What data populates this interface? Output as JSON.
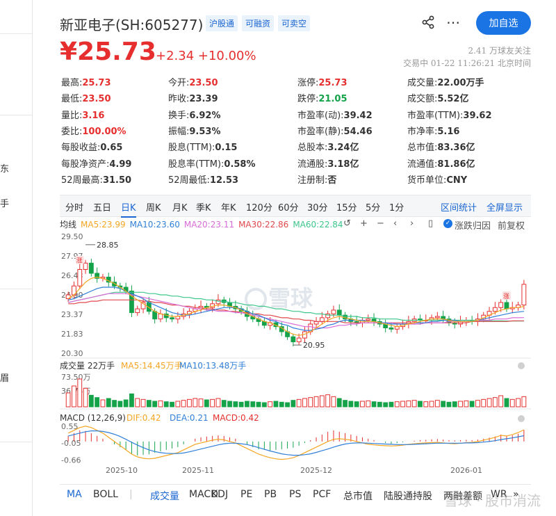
{
  "left_strip": {
    "frag_1": "东",
    "frag_2": "手",
    "frag_3": "眉"
  },
  "header": {
    "name": "新亚电子(SH:605277)",
    "tags": [
      "沪股通",
      "可融资",
      "可卖空"
    ],
    "follow_label": "加自选"
  },
  "price_row": {
    "price": "¥25.73",
    "change": "+2.34 +10.00%",
    "followers": "2.41 万球友关注",
    "status_time": "交易中 01-22 11:26:21 北京时间"
  },
  "quote": [
    [
      {
        "label": "最高:",
        "value": "25.73",
        "color": "red"
      },
      {
        "label": "今开:",
        "value": "23.50",
        "color": "red"
      },
      {
        "label": "涨停:",
        "value": "25.73",
        "color": "red"
      },
      {
        "label": "成交量:",
        "value": "22.00万手",
        "color": ""
      }
    ],
    [
      {
        "label": "最低:",
        "value": "23.50",
        "color": "red"
      },
      {
        "label": "昨收:",
        "value": "23.39",
        "color": ""
      },
      {
        "label": "跌停:",
        "value": "21.05",
        "color": "green"
      },
      {
        "label": "成交额:",
        "value": "5.52亿",
        "color": ""
      }
    ],
    [
      {
        "label": "量比:",
        "value": "3.16",
        "color": "red"
      },
      {
        "label": "换手:",
        "value": "6.92%",
        "color": ""
      },
      {
        "label": "市盈率(动):",
        "value": "39.42",
        "color": ""
      },
      {
        "label": "市盈率(TTM):",
        "value": "39.62",
        "color": ""
      }
    ],
    [
      {
        "label": "委比:",
        "value": "100.00%",
        "color": "red"
      },
      {
        "label": "振幅:",
        "value": "9.53%",
        "color": ""
      },
      {
        "label": "市盈率(静):",
        "value": "54.46",
        "color": ""
      },
      {
        "label": "市净率:",
        "value": "5.16",
        "color": ""
      }
    ],
    [
      {
        "label": "每股收益:",
        "value": "0.65",
        "color": ""
      },
      {
        "label": "股息(TTM):",
        "value": "0.15",
        "color": ""
      },
      {
        "label": "总股本:",
        "value": "3.24亿",
        "color": ""
      },
      {
        "label": "总市值:",
        "value": "83.36亿",
        "color": ""
      }
    ],
    [
      {
        "label": "每股净资产:",
        "value": "4.99",
        "color": ""
      },
      {
        "label": "股息率(TTM):",
        "value": "0.58%",
        "color": ""
      },
      {
        "label": "流通股:",
        "value": "3.18亿",
        "color": ""
      },
      {
        "label": "流通值:",
        "value": "81.86亿",
        "color": ""
      }
    ],
    [
      {
        "label": "52周最高:",
        "value": "31.50",
        "color": ""
      },
      {
        "label": "52周最低:",
        "value": "12.53",
        "color": ""
      },
      {
        "label": "注册制:",
        "value": "否",
        "color": ""
      },
      {
        "label": "货币单位:",
        "value": "CNY",
        "color": ""
      }
    ]
  ],
  "period_tabs": [
    "分时",
    "五日",
    "日K",
    "周K",
    "月K",
    "季K",
    "年K",
    "120分",
    "60分",
    "30分",
    "15分",
    "5分",
    "1分"
  ],
  "active_period": "日K",
  "period_links": [
    "区间统计",
    "全屏显示"
  ],
  "ma_legend": {
    "prefix": "均线",
    "items": [
      {
        "label": "MA5:23.99",
        "color": "#f5a623"
      },
      {
        "label": "MA10:23.60",
        "color": "#2f7fd8"
      },
      {
        "label": "MA20:23.11",
        "color": "#d86bd8"
      },
      {
        "label": "MA30:22.86",
        "color": "#e0474c"
      },
      {
        "label": "MA60:22.84",
        "color": "#3cc68a"
      }
    ]
  },
  "toolbar": {
    "toggle_label": "涨跌归因",
    "adjust_label": "前复权"
  },
  "colors": {
    "up": "#e62e2e",
    "down": "#15a34a",
    "accent": "#1a74e4"
  },
  "chart_data": [
    {
      "type": "candlestick",
      "y_ticks": [
        "29.50",
        "27.97",
        "26.43",
        "24.90",
        "23.37",
        "21.83",
        "20.30"
      ],
      "ylim": [
        20.3,
        29.5
      ],
      "annotations": {
        "high_label": "28.85",
        "low_label": "20.95",
        "up_marker": "涨"
      },
      "close": [
        24.9,
        25.6,
        26.9,
        27.4,
        26.6,
        26.2,
        26.3,
        25.9,
        25.6,
        25.5,
        25.2,
        23.5,
        23.8,
        24.3,
        23.6,
        23.0,
        23.4,
        23.1,
        23.0,
        23.2,
        23.4,
        23.6,
        23.8,
        24.0,
        23.9,
        24.2,
        24.5,
        24.3,
        24.0,
        23.8,
        23.6,
        23.2,
        23.0,
        22.8,
        22.5,
        22.7,
        22.4,
        22.0,
        21.6,
        21.2,
        21.5,
        22.0,
        22.6,
        22.8,
        23.1,
        23.4,
        23.7,
        23.3,
        23.0,
        22.8,
        22.7,
        22.9,
        23.0,
        22.8,
        22.6,
        22.3,
        22.2,
        22.4,
        22.6,
        22.8,
        23.0,
        22.9,
        22.9,
        23.1,
        23.2,
        23.0,
        22.7,
        22.6,
        22.8,
        22.9,
        22.8,
        23.0,
        23.3,
        23.6,
        23.9,
        24.3,
        23.8,
        23.9,
        24.1,
        25.73
      ],
      "ma5": [
        24.6,
        24.9,
        25.4,
        25.9,
        26.2,
        26.3,
        26.2,
        26.0,
        25.8,
        25.5,
        25.2,
        24.8,
        24.5,
        24.2,
        23.9,
        23.6,
        23.4,
        23.3,
        23.2,
        23.2,
        23.3,
        23.4,
        23.6,
        23.7,
        23.9,
        24.0,
        24.1,
        24.1,
        24.0,
        23.9,
        23.7,
        23.4,
        23.2,
        23.0,
        22.8,
        22.7,
        22.5,
        22.3,
        22.0,
        21.8,
        21.7,
        21.8,
        22.0,
        22.3,
        22.6,
        22.9,
        23.1,
        23.2,
        23.1,
        23.0,
        22.9,
        22.8,
        22.8,
        22.8,
        22.7,
        22.6,
        22.5,
        22.4,
        22.5,
        22.6,
        22.7,
        22.8,
        22.9,
        23.0,
        23.0,
        23.0,
        22.9,
        22.8,
        22.8,
        22.8,
        22.8,
        22.9,
        23.1,
        23.3,
        23.5,
        23.7,
        23.8,
        23.9,
        23.9,
        23.99
      ],
      "ma10": [
        24.5,
        24.6,
        24.8,
        25.0,
        25.2,
        25.4,
        25.5,
        25.5,
        25.5,
        25.4,
        25.2,
        25.0,
        24.8,
        24.6,
        24.3,
        24.1,
        23.9,
        23.7,
        23.5,
        23.4,
        23.3,
        23.3,
        23.4,
        23.5,
        23.6,
        23.7,
        23.8,
        23.9,
        23.9,
        23.9,
        23.8,
        23.6,
        23.4,
        23.3,
        23.1,
        22.9,
        22.8,
        22.6,
        22.5,
        22.3,
        22.2,
        22.1,
        22.1,
        22.2,
        22.3,
        22.5,
        22.6,
        22.8,
        22.9,
        22.9,
        22.9,
        22.9,
        22.8,
        22.8,
        22.7,
        22.7,
        22.6,
        22.6,
        22.6,
        22.6,
        22.7,
        22.7,
        22.7,
        22.8,
        22.8,
        22.9,
        22.9,
        22.9,
        22.8,
        22.8,
        22.8,
        22.9,
        23.0,
        23.1,
        23.2,
        23.3,
        23.4,
        23.5,
        23.55,
        23.6
      ],
      "ma20": [
        24.3,
        24.4,
        24.5,
        24.6,
        24.7,
        24.8,
        24.9,
        25.0,
        25.0,
        25.0,
        25.0,
        24.9,
        24.8,
        24.7,
        24.6,
        24.5,
        24.4,
        24.3,
        24.2,
        24.1,
        24.0,
        23.9,
        23.8,
        23.8,
        23.7,
        23.7,
        23.6,
        23.6,
        23.6,
        23.5,
        23.5,
        23.4,
        23.3,
        23.2,
        23.1,
        23.0,
        22.9,
        22.8,
        22.7,
        22.6,
        22.5,
        22.4,
        22.4,
        22.3,
        22.3,
        22.3,
        22.4,
        22.5,
        22.5,
        22.6,
        22.6,
        22.7,
        22.7,
        22.7,
        22.7,
        22.7,
        22.7,
        22.6,
        22.6,
        22.6,
        22.6,
        22.6,
        22.7,
        22.7,
        22.7,
        22.7,
        22.8,
        22.8,
        22.8,
        22.8,
        22.8,
        22.9,
        22.9,
        22.9,
        23.0,
        23.0,
        23.0,
        23.1,
        23.1,
        23.11
      ],
      "ma30": [
        24.2,
        24.2,
        24.3,
        24.3,
        24.4,
        24.4,
        24.5,
        24.5,
        24.5,
        24.5,
        24.5,
        24.5,
        24.5,
        24.4,
        24.4,
        24.3,
        24.3,
        24.2,
        24.1,
        24.1,
        24.0,
        24.0,
        23.9,
        23.9,
        23.8,
        23.8,
        23.7,
        23.7,
        23.6,
        23.6,
        23.5,
        23.5,
        23.4,
        23.4,
        23.3,
        23.3,
        23.2,
        23.1,
        23.1,
        23.0,
        23.0,
        22.9,
        22.9,
        22.8,
        22.8,
        22.8,
        22.8,
        22.8,
        22.7,
        22.7,
        22.7,
        22.7,
        22.7,
        22.7,
        22.7,
        22.7,
        22.7,
        22.7,
        22.7,
        22.7,
        22.7,
        22.7,
        22.7,
        22.7,
        22.7,
        22.7,
        22.7,
        22.7,
        22.7,
        22.7,
        22.8,
        22.8,
        22.8,
        22.8,
        22.8,
        22.8,
        22.8,
        22.85,
        22.86,
        22.86
      ],
      "ma60": [
        24.3,
        24.4,
        24.5,
        24.6,
        24.7,
        24.8,
        24.9,
        25.0,
        25.1,
        25.1,
        25.1,
        25.1,
        25.1,
        25.1,
        25.0,
        25.0,
        24.9,
        24.9,
        24.8,
        24.8,
        24.7,
        24.7,
        24.6,
        24.6,
        24.5,
        24.5,
        24.4,
        24.4,
        24.3,
        24.3,
        24.2,
        24.1,
        24.1,
        24.0,
        24.0,
        23.9,
        23.8,
        23.8,
        23.7,
        23.6,
        23.6,
        23.5,
        23.5,
        23.4,
        23.4,
        23.3,
        23.3,
        23.3,
        23.2,
        23.2,
        23.2,
        23.1,
        23.1,
        23.1,
        23.0,
        23.0,
        23.0,
        23.0,
        22.9,
        22.9,
        22.9,
        22.9,
        22.9,
        22.9,
        22.9,
        22.9,
        22.9,
        22.9,
        22.9,
        22.9,
        22.9,
        22.9,
        22.85,
        22.85,
        22.85,
        22.85,
        22.84,
        22.84,
        22.84,
        22.84
      ]
    },
    {
      "type": "bar",
      "title": "成交量 22万手",
      "legend": [
        {
          "label": "MA5:14.45万手",
          "color": "#f5a623"
        },
        {
          "label": "MA10:13.48万手",
          "color": "#2f7fd8"
        }
      ],
      "y_ticks": [
        "73.50万",
        "36.75万"
      ],
      "ylim": [
        0,
        73.5
      ],
      "values": [
        30,
        45,
        60,
        40,
        25,
        20,
        15,
        18,
        14,
        12,
        15,
        28,
        18,
        16,
        14,
        12,
        13,
        11,
        10,
        12,
        14,
        16,
        18,
        17,
        15,
        16,
        18,
        14,
        12,
        11,
        10,
        12,
        11,
        10,
        9,
        11,
        12,
        10,
        9,
        14,
        16,
        18,
        20,
        22,
        24,
        26,
        22,
        18,
        14,
        12,
        11,
        12,
        13,
        11,
        10,
        9,
        10,
        11,
        12,
        13,
        14,
        12,
        11,
        12,
        14,
        12,
        10,
        11,
        12,
        13,
        12,
        14,
        16,
        18,
        20,
        24,
        18,
        16,
        18,
        22
      ]
    },
    {
      "type": "bar",
      "title": "MACD (12,26,9)",
      "legend": [
        {
          "label": "DIF:0.42",
          "color": "#f5a623"
        },
        {
          "label": "DEA:0.21",
          "color": "#2f7fd8"
        },
        {
          "label": "MACD:0.42",
          "color": "#e62e2e"
        }
      ],
      "y_ticks": [
        "0.55",
        "-0.05",
        "-0.66"
      ],
      "ylim": [
        -0.75,
        0.62
      ],
      "values": [
        0.2,
        0.3,
        0.4,
        0.38,
        0.3,
        0.2,
        0.1,
        0.0,
        -0.1,
        -0.2,
        -0.3,
        -0.45,
        -0.5,
        -0.48,
        -0.46,
        -0.4,
        -0.35,
        -0.3,
        -0.25,
        -0.2,
        -0.1,
        0.0,
        0.1,
        0.15,
        0.18,
        0.2,
        0.22,
        0.2,
        0.15,
        0.1,
        0.0,
        -0.1,
        -0.2,
        -0.28,
        -0.3,
        -0.32,
        -0.3,
        -0.28,
        -0.25,
        -0.22,
        -0.15,
        -0.05,
        0.05,
        0.15,
        0.25,
        0.35,
        0.4,
        0.35,
        0.3,
        0.25,
        0.2,
        0.15,
        0.1,
        0.05,
        0.0,
        -0.05,
        -0.08,
        -0.06,
        -0.03,
        0.0,
        0.03,
        0.05,
        0.06,
        0.08,
        0.09,
        0.07,
        0.05,
        0.04,
        0.05,
        0.06,
        0.05,
        0.07,
        0.1,
        0.14,
        0.18,
        0.25,
        0.2,
        0.22,
        0.28,
        0.42
      ],
      "dif": [
        0.3,
        0.4,
        0.5,
        0.55,
        0.5,
        0.4,
        0.3,
        0.15,
        0.0,
        -0.15,
        -0.3,
        -0.45,
        -0.55,
        -0.6,
        -0.62,
        -0.6,
        -0.55,
        -0.5,
        -0.45,
        -0.4,
        -0.3,
        -0.2,
        -0.1,
        -0.05,
        0.0,
        0.05,
        0.08,
        0.06,
        0.0,
        -0.05,
        -0.15,
        -0.25,
        -0.35,
        -0.45,
        -0.52,
        -0.58,
        -0.62,
        -0.64,
        -0.62,
        -0.58,
        -0.5,
        -0.4,
        -0.3,
        -0.2,
        -0.1,
        0.0,
        0.08,
        0.1,
        0.08,
        0.05,
        0.0,
        -0.05,
        -0.1,
        -0.12,
        -0.14,
        -0.15,
        -0.16,
        -0.15,
        -0.13,
        -0.1,
        -0.08,
        -0.06,
        -0.05,
        -0.04,
        -0.03,
        -0.05,
        -0.07,
        -0.08,
        -0.06,
        -0.04,
        -0.03,
        0.0,
        0.05,
        0.1,
        0.15,
        0.22,
        0.2,
        0.25,
        0.32,
        0.42
      ],
      "dea": [
        0.2,
        0.25,
        0.3,
        0.35,
        0.38,
        0.38,
        0.36,
        0.32,
        0.26,
        0.18,
        0.08,
        -0.03,
        -0.13,
        -0.22,
        -0.3,
        -0.36,
        -0.4,
        -0.42,
        -0.43,
        -0.43,
        -0.41,
        -0.37,
        -0.32,
        -0.27,
        -0.22,
        -0.17,
        -0.12,
        -0.08,
        -0.06,
        -0.06,
        -0.08,
        -0.11,
        -0.16,
        -0.22,
        -0.28,
        -0.34,
        -0.39,
        -0.44,
        -0.47,
        -0.49,
        -0.49,
        -0.47,
        -0.44,
        -0.39,
        -0.33,
        -0.27,
        -0.2,
        -0.14,
        -0.09,
        -0.06,
        -0.05,
        -0.05,
        -0.06,
        -0.07,
        -0.08,
        -0.09,
        -0.1,
        -0.11,
        -0.11,
        -0.11,
        -0.1,
        -0.09,
        -0.08,
        -0.07,
        -0.06,
        -0.06,
        -0.06,
        -0.06,
        -0.06,
        -0.05,
        -0.05,
        -0.04,
        -0.02,
        0.0,
        0.03,
        0.07,
        0.1,
        0.13,
        0.17,
        0.21
      ]
    }
  ],
  "x_ticks": [
    "2025-10",
    "2025-11",
    "2025-12",
    "2026-01"
  ],
  "watermark": "雪球",
  "bottom_tabs": [
    "MA",
    "BOLL",
    "|",
    "成交量",
    "MACD",
    "KDJ",
    "PE",
    "PB",
    "PS",
    "PCF",
    "总市值",
    "陆股通持股",
    "两融差额",
    "WR",
    "»"
  ],
  "bottom_watermark": "雪球 · 股市消流"
}
